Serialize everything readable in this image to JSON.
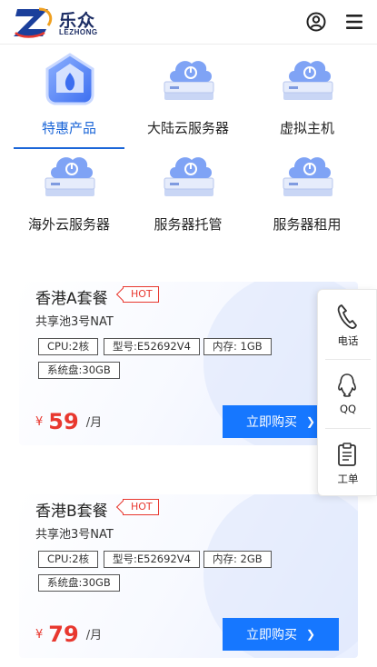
{
  "header": {
    "logo_cn": "乐众",
    "logo_en": "LEZHONG"
  },
  "categories": [
    {
      "label": "特惠产品",
      "active": true,
      "icon": "shield-house-icon"
    },
    {
      "label": "大陆云服务器",
      "active": false,
      "icon": "cloud-server-icon"
    },
    {
      "label": "虚拟主机",
      "active": false,
      "icon": "cloud-server-icon"
    },
    {
      "label": "海外云服务器",
      "active": false,
      "icon": "cloud-server-icon"
    },
    {
      "label": "服务器托管",
      "active": false,
      "icon": "cloud-server-icon"
    },
    {
      "label": "服务器租用",
      "active": false,
      "icon": "cloud-server-icon"
    }
  ],
  "products": [
    {
      "title": "香港A套餐",
      "badge": "HOT",
      "subtitle": "共享池3号NAT",
      "specs": [
        "CPU:2核",
        "型号:E52692V4",
        "内存: 1GB",
        "系统盘:30GB"
      ],
      "currency": "¥",
      "price": "59",
      "unit": "/月",
      "buy_label": "立即购买"
    },
    {
      "title": "香港B套餐",
      "badge": "HOT",
      "subtitle": "共享池3号NAT",
      "specs": [
        "CPU:2核",
        "型号:E52692V4",
        "内存: 2GB",
        "系统盘:30GB"
      ],
      "currency": "¥",
      "price": "79",
      "unit": "/月",
      "buy_label": "立即购买"
    }
  ],
  "float_panel": {
    "phone": "电话",
    "qq": "QQ",
    "ticket": "工单"
  },
  "colors": {
    "accent": "#1677ff",
    "active_tab": "#1b66d8",
    "price": "#e8382f",
    "brand": "#1b2c63"
  }
}
